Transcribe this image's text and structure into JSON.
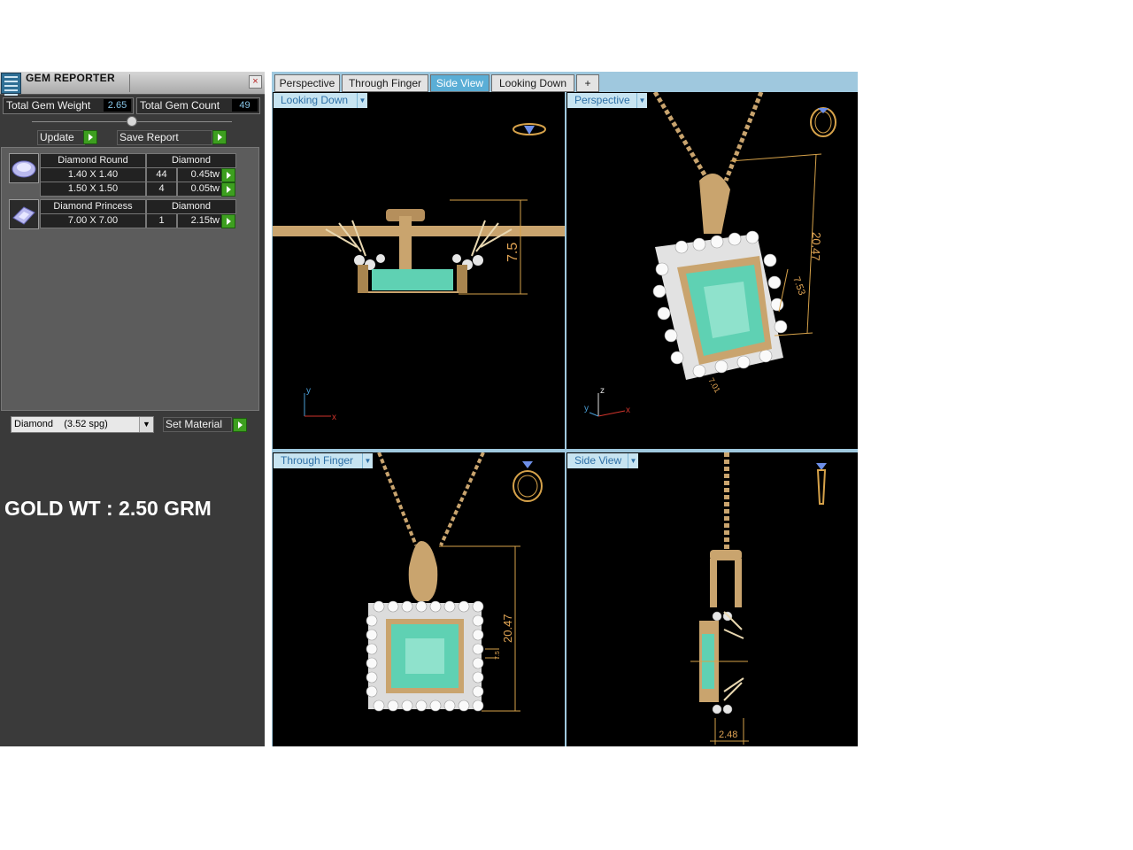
{
  "panel": {
    "title": "GEM REPORTER",
    "close_label": "×",
    "total_gem_weight_label": "Total Gem Weight",
    "total_gem_weight_value": "2.65",
    "total_gem_count_label": "Total Gem Count",
    "total_gem_count_value": "49",
    "update_label": "Update",
    "save_report_label": "Save Report",
    "gems": [
      {
        "name": "Diamond Round",
        "material": "Diamond",
        "rows": [
          {
            "size": "1.40 X 1.40",
            "count": "44",
            "weight": "0.45tw"
          },
          {
            "size": "1.50 X 1.50",
            "count": "4",
            "weight": "0.05tw"
          }
        ]
      },
      {
        "name": "Diamond Princess",
        "material": "Diamond",
        "rows": [
          {
            "size": "7.00 X 7.00",
            "count": "1",
            "weight": "2.15tw"
          }
        ]
      }
    ],
    "material_select": "Diamond    (3.52 spg)",
    "set_material_label": "Set Material"
  },
  "annotation": {
    "gold_weight": "GOLD WT : 2.50 GRM"
  },
  "viewer": {
    "tabs": [
      "Perspective",
      "Through Finger",
      "Side View",
      "Looking Down"
    ],
    "active_tab": "Side View",
    "add_tab_label": "+",
    "viewports": [
      {
        "label": "Looking Down",
        "dims": [
          "7.5"
        ],
        "axes": [
          "y",
          "x"
        ]
      },
      {
        "label": "Perspective",
        "dims": [
          "20.47",
          "7.53",
          "7.01"
        ],
        "axes": [
          "z",
          "y",
          "x"
        ]
      },
      {
        "label": "Through Finger",
        "dims": [
          "20.47",
          "7.5"
        ]
      },
      {
        "label": "Side View",
        "dims": [
          "2.48"
        ]
      }
    ]
  },
  "colors": {
    "gold": "#c9a46e",
    "gem": "#5fd1b3",
    "accent": "#5aaed6",
    "panel": "#3a3a3a"
  },
  "icons": {
    "gem_round": "round-gem-icon",
    "gem_princess": "princess-gem-icon",
    "ring": "ring-icon"
  }
}
